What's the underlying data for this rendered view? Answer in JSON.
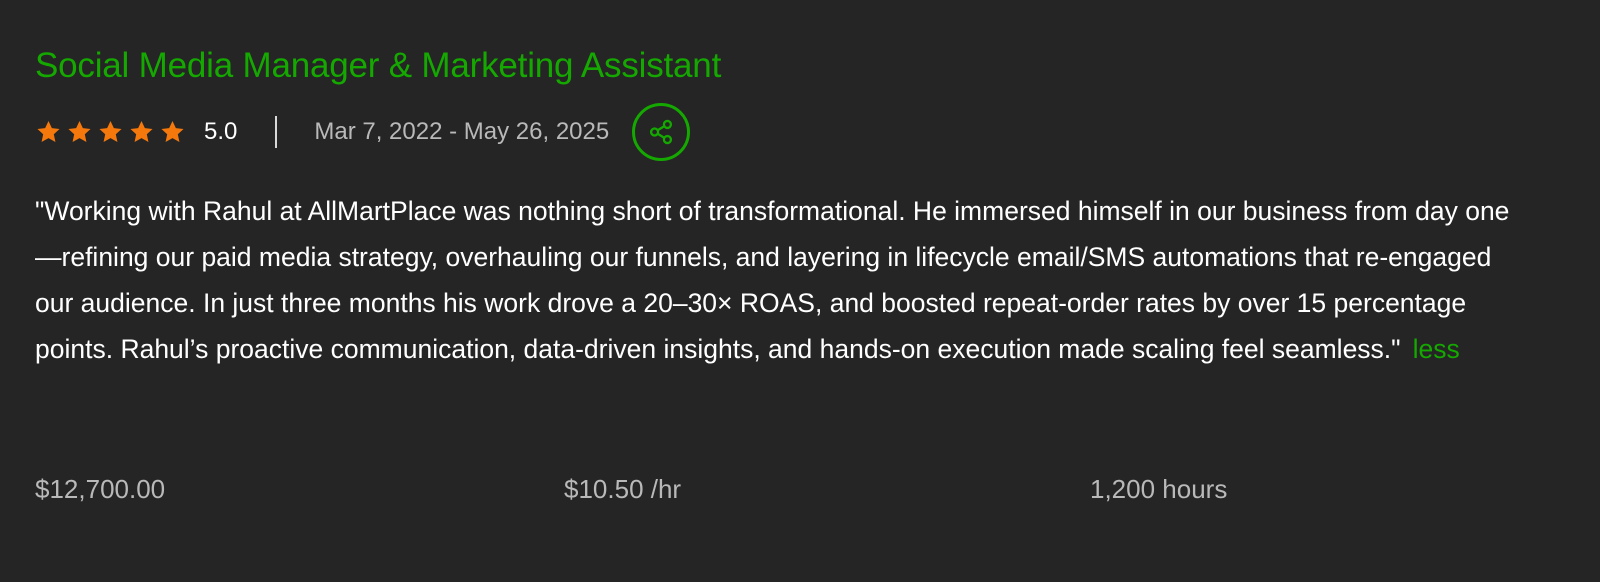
{
  "job": {
    "title": "Social Media Manager & Marketing Assistant",
    "rating": "5.0",
    "stars": 5,
    "star_color": "#f4780b",
    "dates": "Mar 7, 2022 - May 26, 2025",
    "share_icon": "share-icon",
    "review": "\"Working with Rahul at AllMartPlace was nothing short of transformational. He immersed himself in our business from day one—refining our paid media strategy, overhauling our funnels, and layering in lifecycle email/SMS automations that re-engaged our audience. In just three months his work drove a 20–30× ROAS, and boosted repeat-order rates by over 15 percentage points. Rahul’s proactive communication, data-driven insights, and hands-on execution made scaling feel seamless.\"",
    "less_label": "less",
    "earned": "$12,700.00",
    "rate": "$10.50 /hr",
    "hours": "1,200 hours"
  },
  "colors": {
    "background": "#252525",
    "accent": "#14a800",
    "muted_text": "#b9b9b9",
    "text": "#ffffff"
  }
}
